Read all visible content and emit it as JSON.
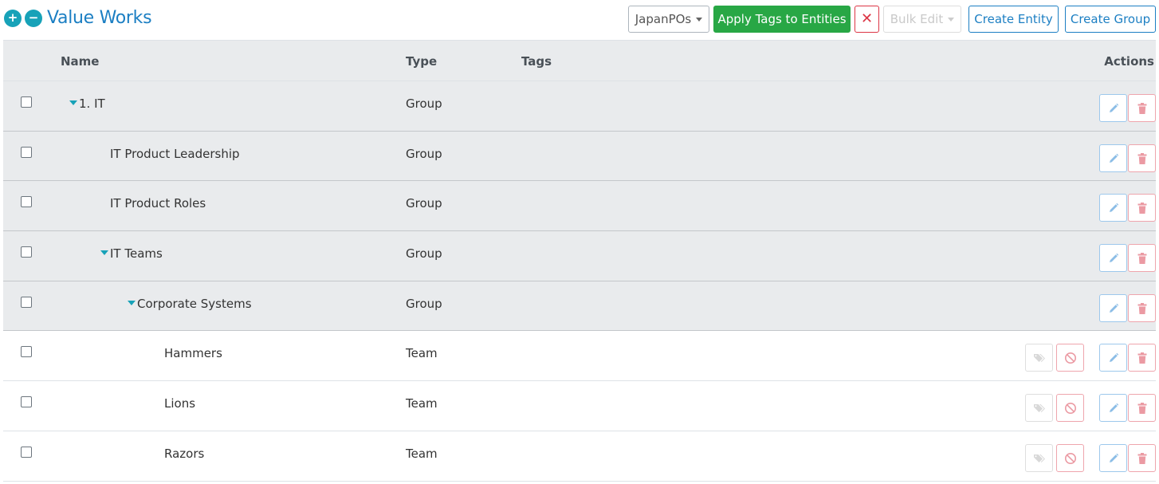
{
  "header": {
    "title": "Value Works",
    "expand_symbol": "+",
    "collapse_symbol": "−",
    "tag_select": "JapanPOs",
    "apply_label": "Apply Tags to Entities",
    "clear_symbol": "✕",
    "bulk_edit_label": "Bulk Edit",
    "create_entity_label": "Create Entity",
    "create_group_label": "Create Group"
  },
  "table": {
    "columns": {
      "name": "Name",
      "type": "Type",
      "tags": "Tags",
      "actions": "Actions"
    },
    "rows": [
      {
        "name": "1. IT",
        "type": "Group",
        "level": 0,
        "expandable": true
      },
      {
        "name": "IT Product Leadership",
        "type": "Group",
        "level": 1,
        "expandable": false
      },
      {
        "name": "IT Product Roles",
        "type": "Group",
        "level": 1,
        "expandable": false
      },
      {
        "name": "IT Teams",
        "type": "Group",
        "level": 1,
        "expandable": true
      },
      {
        "name": "Corporate Systems",
        "type": "Group",
        "level": 2,
        "expandable": true
      },
      {
        "name": "Hammers",
        "type": "Team",
        "level": 3,
        "expandable": false
      },
      {
        "name": "Lions",
        "type": "Team",
        "level": 3,
        "expandable": false
      },
      {
        "name": "Razors",
        "type": "Team",
        "level": 3,
        "expandable": false
      }
    ]
  },
  "icons": {
    "edit": "pencil-icon",
    "delete": "trash-icon",
    "block": "ban-icon",
    "tag": "tags-icon"
  },
  "colors": {
    "brand": "#1c7fc3",
    "success": "#28a745",
    "danger": "#dc3545",
    "teal": "#17a2b8"
  }
}
